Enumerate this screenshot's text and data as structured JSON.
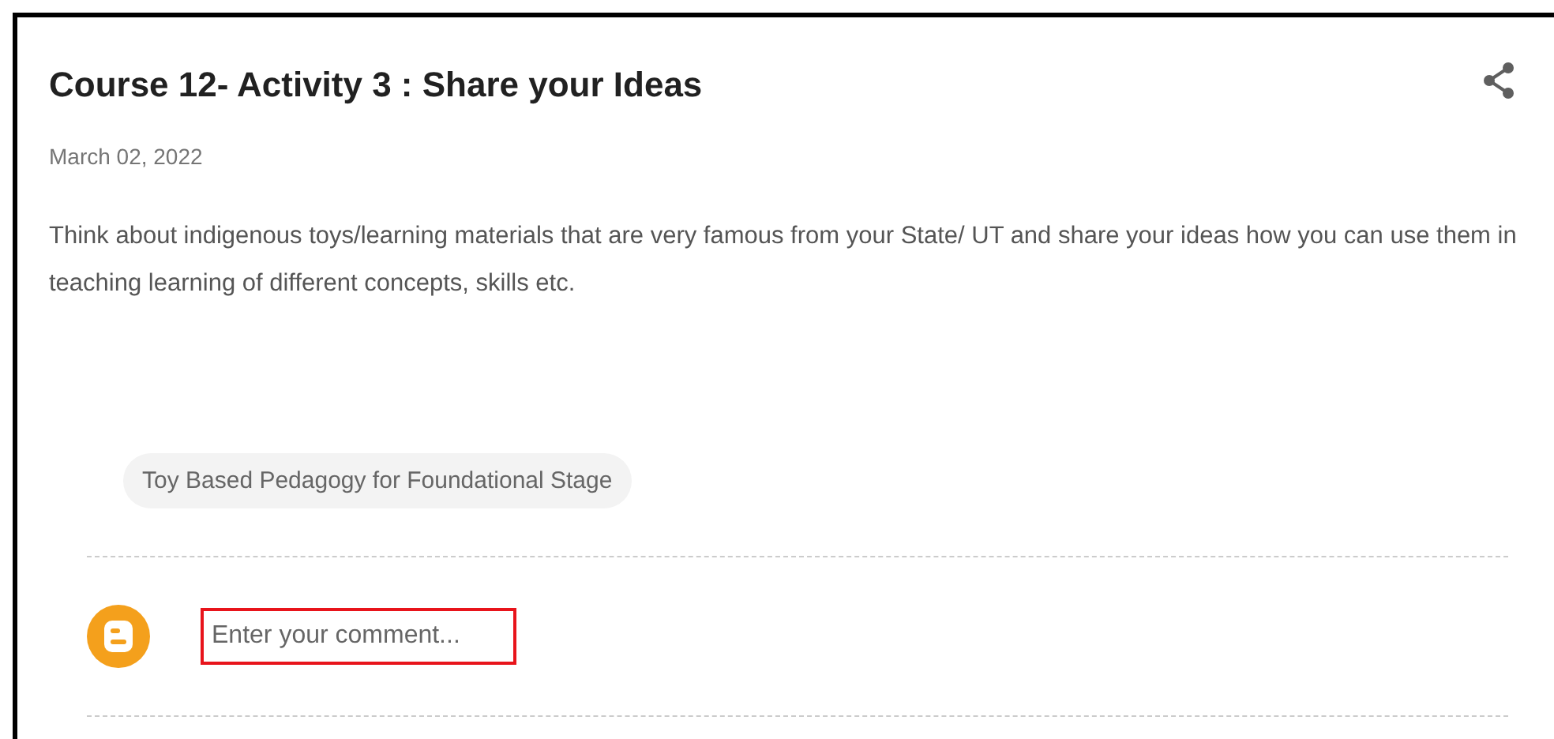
{
  "post": {
    "title": "Course 12- Activity 3 : Share your Ideas",
    "date": "March 02, 2022",
    "body": "Think about indigenous toys/learning materials that are very famous from your State/ UT and share your ideas how you can use them in teaching learning of different concepts, skills etc.",
    "labels": [
      "Toy Based Pedagogy for Foundational Stage"
    ]
  },
  "comment": {
    "placeholder": "Enter your comment...",
    "highlighted": true
  }
}
